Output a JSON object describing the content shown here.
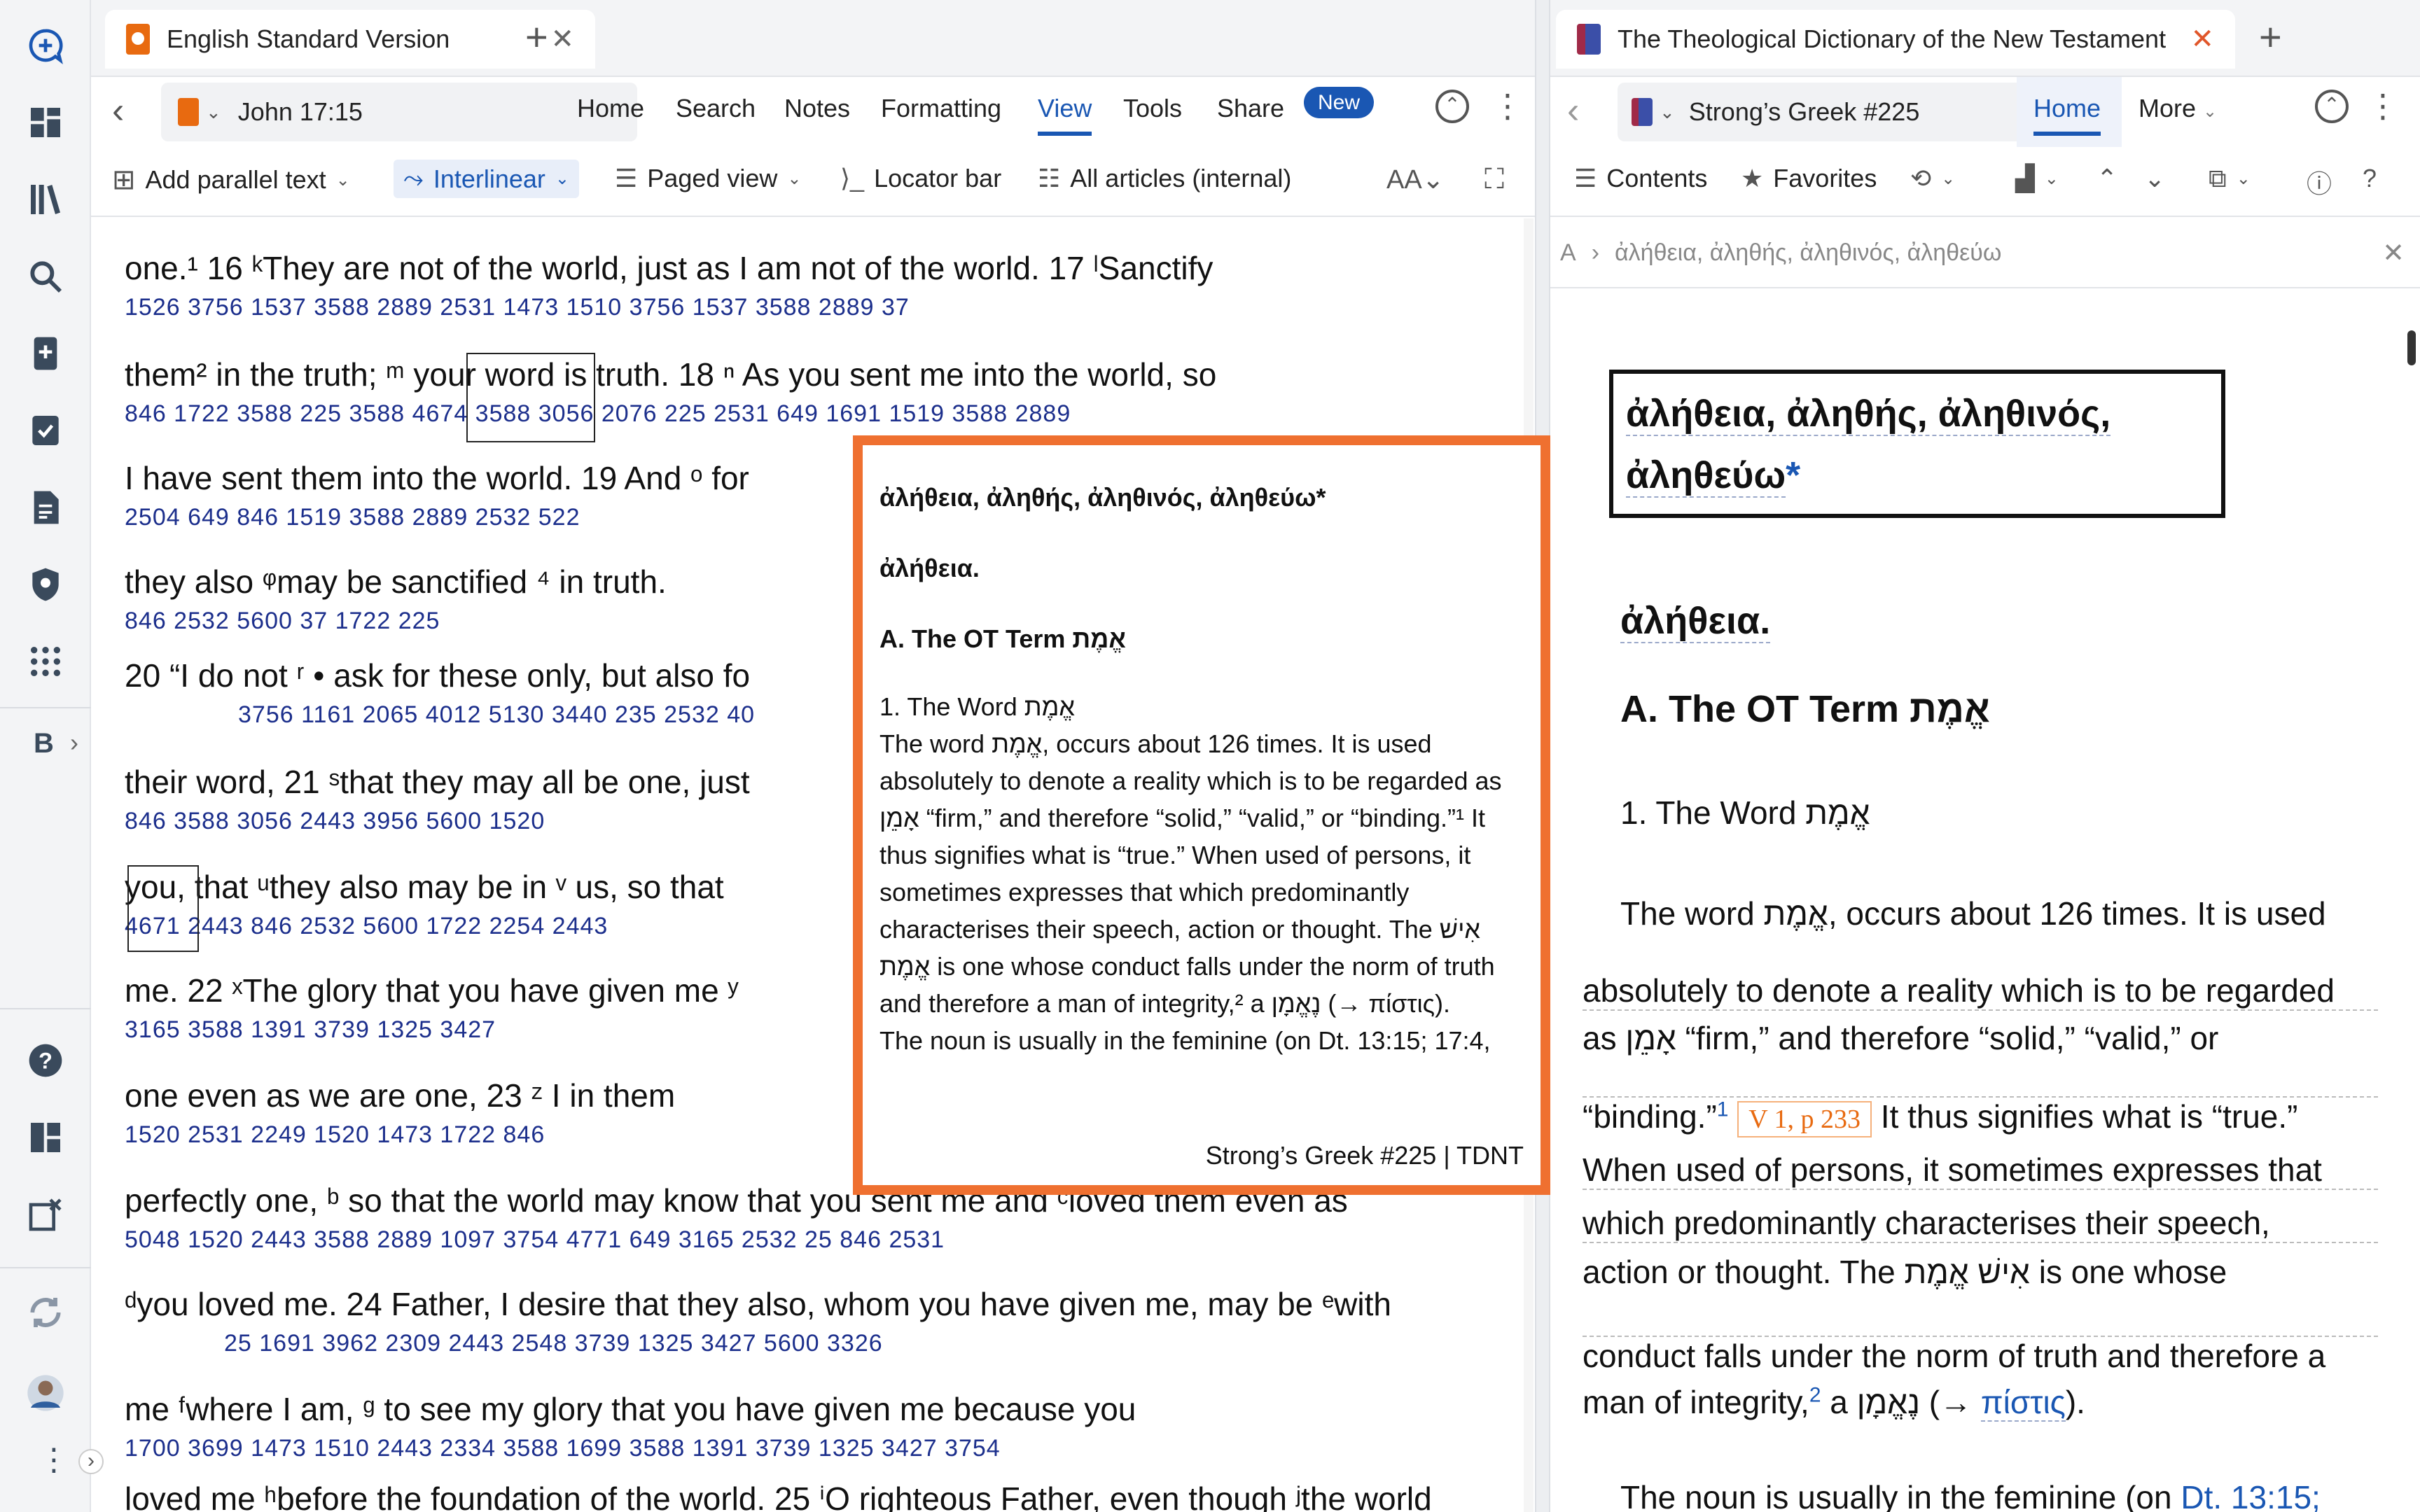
{
  "rail": {
    "icons": [
      "new-panel-icon",
      "dashboard-icon",
      "library-icon",
      "search-icon",
      "add-document-icon",
      "checklist-icon",
      "notes-icon",
      "shield-icon",
      "apps-icon"
    ],
    "bible_label": "B",
    "bottom_icons": [
      "help-icon",
      "layout-icon",
      "close-panels-icon",
      "sync-icon",
      "user-avatar",
      "more-vertical-icon"
    ]
  },
  "left_tab": {
    "title": "English Standard Version"
  },
  "right_tab": {
    "title": "The Theological Dictionary of the New Testament"
  },
  "left_nav": {
    "reference": "John 17:15",
    "menu": [
      "Home",
      "Search",
      "Notes",
      "Formatting",
      "View",
      "Tools",
      "Share"
    ],
    "new_badge": "New"
  },
  "left_subtools": {
    "parallel": "Add parallel text",
    "interlinear": "Interlinear",
    "paged": "Paged view",
    "locator": "Locator bar",
    "articles": "All articles (internal)"
  },
  "right_nav": {
    "reference": "Strong’s Greek #225",
    "home": "Home",
    "more": "More"
  },
  "right_subtools": {
    "contents": "Contents",
    "favorites": "Favorites"
  },
  "right_crumb": {
    "letter": "A",
    "path": "ἀλήθεια, ἀληθής, ἀληθινός, ἀληθεύω"
  },
  "bible_lines": [
    {
      "text": "one.¹  16 ᵏThey are not of the world, just as I am not of the world.  17 ˡSanctify",
      "nums": "1526 3756 1537 3588  2889           2531 1473 1510 3756 1537 3588  2889           37"
    },
    {
      "text": "them²  in the truth; ᵐ your word is truth.  18 ⁿ As you sent me into the world, so",
      "nums": "846    1722 3588  225   3588 4674 3588 3056 2076  225       2531   649 1691 1519 3588  2889"
    },
    {
      "text": "I have sent them into the world.  19 And ᵒ for",
      "nums": "2504        649   846  1519 3588  2889         2532  522"
    },
    {
      "text": "they also ᵠmay be sanctified ⁴ in truth.",
      "nums": "846  2532      5600       37       1722  225"
    },
    {
      "text": "20 “I do not ʳ • ask for these only, but also fo",
      "nums": "3756  1161 2065 4012  5130  3440  235 2532 40"
    },
    {
      "text": "their word,  21 ˢthat they may all be one, just",
      "nums": "846  3588 3056      2443        3956 5600 1520"
    },
    {
      "text": "you, that ᵘthey also may be in ᵛ us, so that",
      "nums": "4671  2443   846  2532      5600 1722  2254 2443"
    },
    {
      "text": "me.  22 ˣThe glory that you have given me ʸ",
      "nums": "3165      3588  1391  3739              1325  3427"
    },
    {
      "text": "one even as we are one,  23 ᶻ I in them",
      "nums": "1520      2531 2249  1520         1473 1722  846"
    },
    {
      "text": "perfectly one, ᵇ so that the world may know that you sent me and ᶜloved them even as",
      "nums": "5048      1520   2443      3588  2889        1097 3754 4771  649 3165 2532  25   846      2531"
    },
    {
      "text": "ᵈyou loved me.  24 Father, I desire that they also, whom you have given me, may be ᵉwith",
      "nums": "25  1691          3962       2309 2443 2548          3739          1325 3427      5600 3326"
    },
    {
      "text": "me ᶠwhere I am, ᵍ to see my glory that you have given me because you",
      "nums": "1700  3699 1473 1510   2443 2334 3588 1699 3588 1391  3739          1325  3427     3754"
    },
    {
      "text": "loved me ʰbefore the foundation of the world.  25 ⁱO righteous Father, even though ʲthe world",
      "nums": ""
    }
  ],
  "popup": {
    "heading": "ἀλήθεια, ἀληθής, ἀληθινός, ἀληθεύω*",
    "sub": "ἀλήθεια.",
    "section": "A.    The OT Term אֱמֶת",
    "item": "1.    The Word אֱמֶת",
    "body": "The word אֱמֶת, occurs about 126 times. It is used absolutely to denote a reality which is to be regarded as אָמֵן “firm,” and therefore “solid,” “valid,” or “binding.”¹ It thus signifies what is “true.” When used of persons, it sometimes expresses that which predominantly characterises their speech, action or thought. The אִישׁ אֱמֶת is one whose conduct falls under the norm of truth and therefore a man of integrity,² a נֶאֱמָן (→ πίστις).",
    "tail": "The noun is usually in the feminine (on Dt. 13:15; 17:4,",
    "footer": "Strong’s Greek #225 |  TDNT"
  },
  "article": {
    "title_line1": "ἀλήθεια, ἀληθής, ἀληθινός,",
    "title_line2": "ἀληθεύω",
    "title_star": "*",
    "subhead": "ἀλήθεια.",
    "section": "A. The OT Term אֱמֶת",
    "item": "1.  The Word אֱמֶת",
    "p1": "The word אֱמֶת, occurs about 126 times. It is used",
    "p2": "absolutely to denote a reality which is to be regarded",
    "p3": "as  אָמֵן  “firm,”  and  therefore  “solid,”  “valid,”  or",
    "p4a": "“binding.”",
    "p4fn": "1",
    "p4ref": "V 1, p 233",
    "p4b": "It thus signifies what is “true.”",
    "p5": "When used of persons, it sometimes expresses that",
    "p6": "which  predominantly  characterises  their  speech,",
    "p7": "action  or  thought.  The  אִישׁ אֱמֶת  is  one  whose",
    "p8": "conduct falls under the norm of truth and therefore a",
    "p9a": "man of integrity,",
    "p9fn": "2",
    "p9b": " a נֶאֱמָן (→ ",
    "p9link": "πίστις",
    "p9c": ").",
    "p10a": "The noun is usually in the feminine (on ",
    "p10link": "Dt. 13:15;"
  }
}
